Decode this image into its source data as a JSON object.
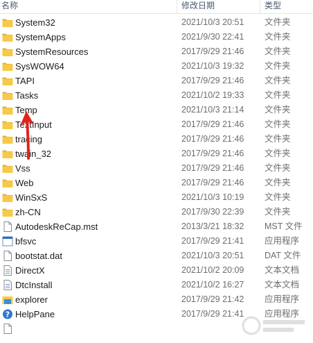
{
  "header": {
    "name": "名称",
    "date": "修改日期",
    "type": "类型"
  },
  "rows": [
    {
      "name": "System32",
      "date": "2021/10/3 20:51",
      "type": "文件夹",
      "icon": "folder-icon"
    },
    {
      "name": "SystemApps",
      "date": "2021/9/30 22:41",
      "type": "文件夹",
      "icon": "folder-icon"
    },
    {
      "name": "SystemResources",
      "date": "2017/9/29 21:46",
      "type": "文件夹",
      "icon": "folder-icon"
    },
    {
      "name": "SysWOW64",
      "date": "2021/10/3 19:32",
      "type": "文件夹",
      "icon": "folder-icon"
    },
    {
      "name": "TAPI",
      "date": "2017/9/29 21:46",
      "type": "文件夹",
      "icon": "folder-icon"
    },
    {
      "name": "Tasks",
      "date": "2021/10/2 19:33",
      "type": "文件夹",
      "icon": "folder-icon"
    },
    {
      "name": "Temp",
      "date": "2021/10/3 21:14",
      "type": "文件夹",
      "icon": "folder-icon"
    },
    {
      "name": "TextInput",
      "date": "2017/9/29 21:46",
      "type": "文件夹",
      "icon": "folder-icon"
    },
    {
      "name": "tracing",
      "date": "2017/9/29 21:46",
      "type": "文件夹",
      "icon": "folder-icon"
    },
    {
      "name": "twain_32",
      "date": "2017/9/29 21:46",
      "type": "文件夹",
      "icon": "folder-icon"
    },
    {
      "name": "Vss",
      "date": "2017/9/29 21:46",
      "type": "文件夹",
      "icon": "folder-icon"
    },
    {
      "name": "Web",
      "date": "2017/9/29 21:46",
      "type": "文件夹",
      "icon": "folder-icon"
    },
    {
      "name": "WinSxS",
      "date": "2021/10/3 10:19",
      "type": "文件夹",
      "icon": "folder-icon"
    },
    {
      "name": "zh-CN",
      "date": "2017/9/30 22:39",
      "type": "文件夹",
      "icon": "folder-icon"
    },
    {
      "name": "AutodeskReCap.mst",
      "date": "2013/3/21 18:32",
      "type": "MST 文件",
      "icon": "document-icon"
    },
    {
      "name": "bfsvc",
      "date": "2017/9/29 21:41",
      "type": "应用程序",
      "icon": "app-icon"
    },
    {
      "name": "bootstat.dat",
      "date": "2021/10/3 20:51",
      "type": "DAT 文件",
      "icon": "document-icon"
    },
    {
      "name": "DirectX",
      "date": "2021/10/2 20:09",
      "type": "文本文档",
      "icon": "text-document-icon"
    },
    {
      "name": "DtcInstall",
      "date": "2021/10/2 16:27",
      "type": "文本文档",
      "icon": "text-document-icon"
    },
    {
      "name": "explorer",
      "date": "2017/9/29 21:42",
      "type": "应用程序",
      "icon": "explorer-folder-icon"
    },
    {
      "name": "HelpPane",
      "date": "2017/9/29 21:41",
      "type": "应用程序",
      "icon": "help-icon"
    },
    {
      "name": "",
      "date": "",
      "type": "",
      "icon": "document-icon"
    }
  ],
  "colors": {
    "folder": "#f7c948",
    "folder_dark": "#e8ae2c",
    "arrow": "#e0231b",
    "header_text": "#4a5a6e"
  }
}
